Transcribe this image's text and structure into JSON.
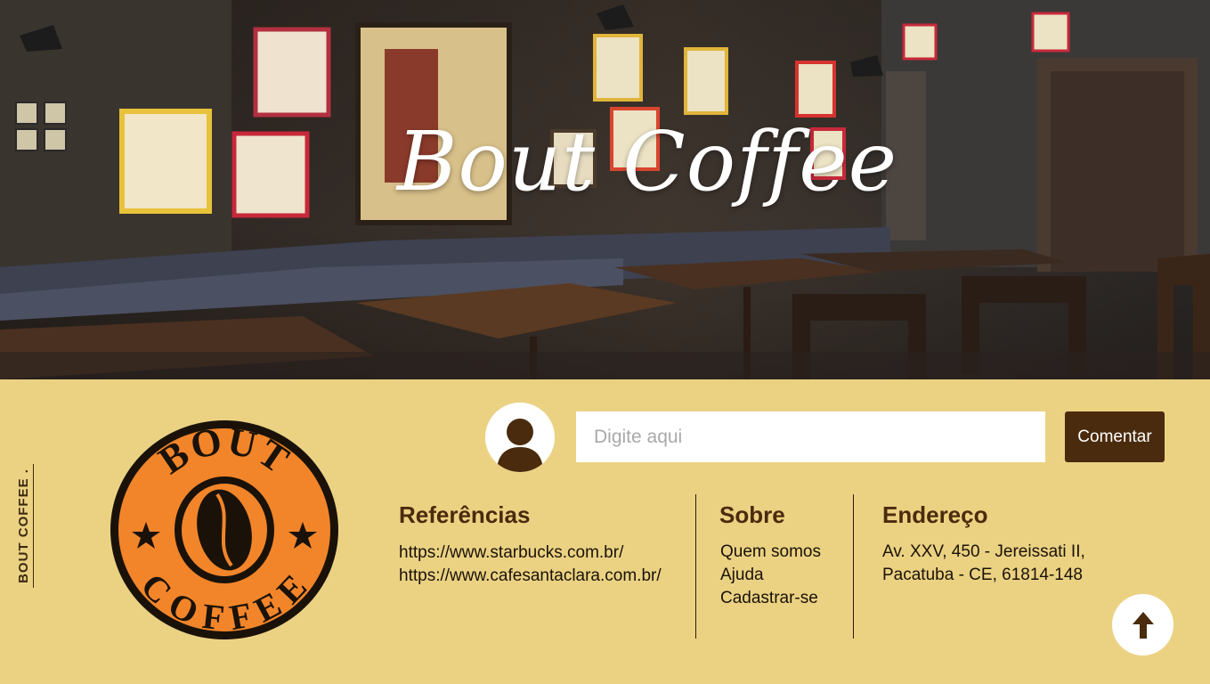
{
  "hero": {
    "title": "Bout Coffee"
  },
  "sidebar": {
    "label": "BOUT COFFEE ."
  },
  "logo": {
    "top_text": "BOUT",
    "bottom_text": "COFFEE"
  },
  "comment": {
    "placeholder": "Digite aqui",
    "button_label": "Comentar"
  },
  "references": {
    "title": "Referências",
    "links": [
      "https://www.starbucks.com.br/",
      "https://www.cafesantaclara.com.br/"
    ]
  },
  "about": {
    "title": "Sobre",
    "items": [
      "Quem somos",
      "Ajuda",
      "Cadastrar-se"
    ]
  },
  "address": {
    "title": "Endereço",
    "lines": [
      "Av. XXV, 450 - Jereissati II,",
      "Pacatuba - CE, 61814-148"
    ]
  },
  "icons": {
    "avatar": "user-avatar-icon",
    "back_to_top": "arrow-up-icon"
  },
  "colors": {
    "footer_bg": "#ebd283",
    "brand_brown": "#4a2b0d",
    "logo_orange": "#f2852a"
  }
}
